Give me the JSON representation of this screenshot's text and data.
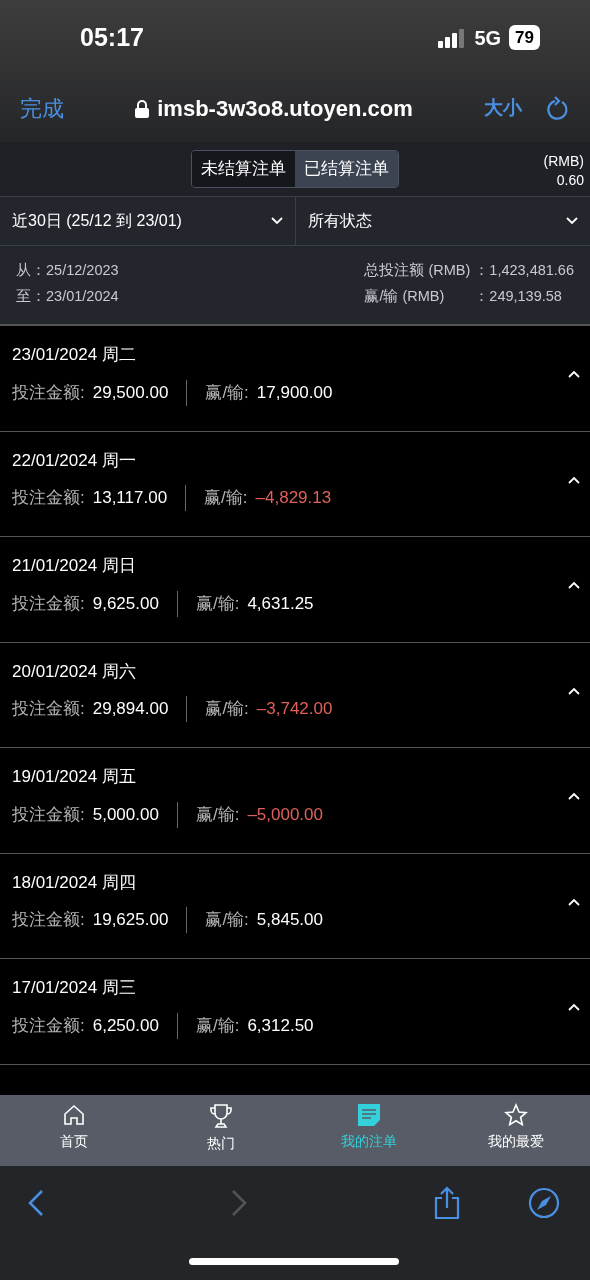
{
  "status_bar": {
    "time": "05:17",
    "network": "5G",
    "battery": "79"
  },
  "browser": {
    "done": "完成",
    "url": "imsb-3w3o8.utoyen.com",
    "text_size": "大小"
  },
  "tabs": [
    {
      "label": "未结算注单",
      "selected": false
    },
    {
      "label": "已结算注单",
      "selected": true
    }
  ],
  "currency": {
    "unit": "(RMB)",
    "value": "0.60"
  },
  "filters": [
    {
      "label": "近30日 (25/12 到 23/01)"
    },
    {
      "label": "所有状态"
    }
  ],
  "summary": {
    "from_label": "从：",
    "from": "25/12/2023",
    "to_label": "至：",
    "to": "23/01/2024",
    "total_label": "总投注额 (RMB)",
    "total": "：1,423,481.66",
    "winloss_label": "赢/输 (RMB)",
    "winloss": "：249,139.58"
  },
  "days": [
    {
      "date": "23/01/2024 周二",
      "stake_label": "投注金额:",
      "stake": "29,500.00",
      "result_label": "赢/输:",
      "result": "17,900.00",
      "negative": false
    },
    {
      "date": "22/01/2024 周一",
      "stake_label": "投注金额:",
      "stake": "13,117.00",
      "result_label": "赢/输:",
      "result": "–4,829.13",
      "negative": true
    },
    {
      "date": "21/01/2024 周日",
      "stake_label": "投注金额:",
      "stake": "9,625.00",
      "result_label": "赢/输:",
      "result": "4,631.25",
      "negative": false
    },
    {
      "date": "20/01/2024 周六",
      "stake_label": "投注金额:",
      "stake": "29,894.00",
      "result_label": "赢/输:",
      "result": "–3,742.00",
      "negative": true
    },
    {
      "date": "19/01/2024 周五",
      "stake_label": "投注金额:",
      "stake": "5,000.00",
      "result_label": "赢/输:",
      "result": "–5,000.00",
      "negative": true
    },
    {
      "date": "18/01/2024 周四",
      "stake_label": "投注金额:",
      "stake": "19,625.00",
      "result_label": "赢/输:",
      "result": "5,845.00",
      "negative": false
    },
    {
      "date": "17/01/2024 周三",
      "stake_label": "投注金额:",
      "stake": "6,250.00",
      "result_label": "赢/输:",
      "result": "6,312.50",
      "negative": false
    }
  ],
  "nav": [
    {
      "label": "首页",
      "kind": "home",
      "selected": false
    },
    {
      "label": "热门",
      "kind": "trophy",
      "selected": false
    },
    {
      "label": "我的注单",
      "kind": "note",
      "selected": true
    },
    {
      "label": "我的最爱",
      "kind": "star",
      "selected": false
    }
  ]
}
